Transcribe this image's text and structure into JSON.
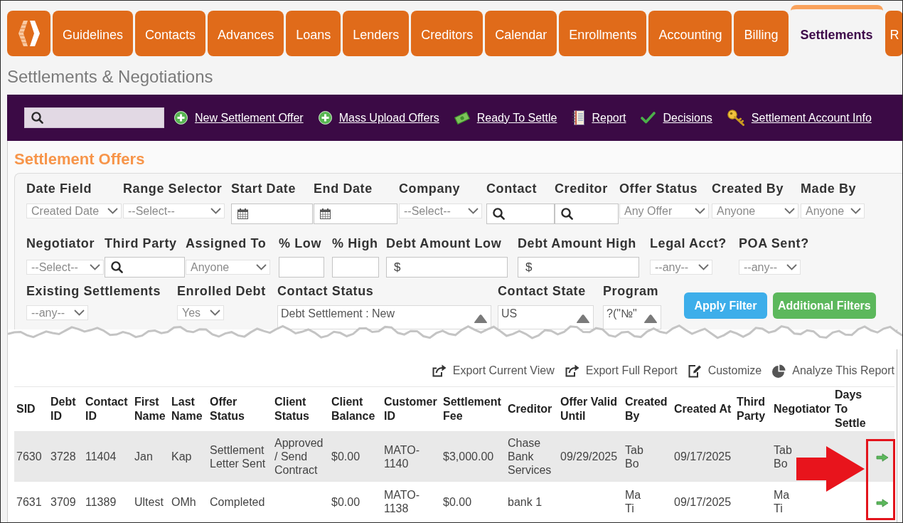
{
  "nav": {
    "tabs": [
      {
        "label": "Guidelines",
        "selected": false
      },
      {
        "label": "Contacts",
        "selected": false
      },
      {
        "label": "Advances",
        "selected": false
      },
      {
        "label": "Loans",
        "selected": false
      },
      {
        "label": "Lenders",
        "selected": false
      },
      {
        "label": "Creditors",
        "selected": false
      },
      {
        "label": "Calendar",
        "selected": false
      },
      {
        "label": "Enrollments",
        "selected": false
      },
      {
        "label": "Accounting",
        "selected": false
      },
      {
        "label": "Billing",
        "selected": false
      },
      {
        "label": "Settlements",
        "selected": true
      },
      {
        "label": "R",
        "selected": false
      }
    ]
  },
  "page_title": "Settlements & Negotiations",
  "toolbar": {
    "links": [
      {
        "label": "New Settlement Offer"
      },
      {
        "label": "Mass Upload Offers"
      },
      {
        "label": "Ready To Settle"
      },
      {
        "label": "Report"
      },
      {
        "label": "Decisions"
      },
      {
        "label": "Settlement Account Info"
      }
    ]
  },
  "settlement_offers": {
    "title": "Settlement Offers",
    "filter_rows": [
      {
        "fields": [
          {
            "label": "Date Field",
            "kind": "select",
            "value": "Created Date"
          },
          {
            "label": "Range Selector",
            "kind": "select",
            "value": "--Select--"
          },
          {
            "label": "Start Date",
            "kind": "date"
          },
          {
            "label": "End Date",
            "kind": "date"
          },
          {
            "label": "Company",
            "kind": "select",
            "value": "--Select--"
          },
          {
            "label": "Contact",
            "kind": "search"
          },
          {
            "label": "Creditor",
            "kind": "search"
          },
          {
            "label": "Offer Status",
            "kind": "select",
            "value": "Any Offer"
          },
          {
            "label": "Created By",
            "kind": "select",
            "value": "Anyone"
          },
          {
            "label": "Made By",
            "kind": "select",
            "value": "Anyone"
          }
        ]
      },
      {
        "fields": [
          {
            "label": "Negotiator",
            "kind": "select",
            "value": "--Select--"
          },
          {
            "label": "Third Party",
            "kind": "search"
          },
          {
            "label": "Assigned To",
            "kind": "select",
            "value": "Anyone"
          },
          {
            "label": "% Low",
            "kind": "text"
          },
          {
            "label": "% High",
            "kind": "text"
          },
          {
            "label": "Debt Amount Low",
            "kind": "money",
            "prefix": "$"
          },
          {
            "label": "Debt Amount High",
            "kind": "money",
            "prefix": "$"
          },
          {
            "label": "Legal Acct?",
            "kind": "select",
            "value": "--any--"
          },
          {
            "label": "POA Sent?",
            "kind": "select",
            "value": "--any--"
          }
        ]
      },
      {
        "fields": [
          {
            "label": "Existing Settlements",
            "kind": "select",
            "value": "--any--"
          },
          {
            "label": "Enrolled Debt",
            "kind": "select",
            "value": "Yes"
          },
          {
            "label": "Contact Status",
            "kind": "listbox",
            "options": [
              "Debt Settlement : New"
            ]
          },
          {
            "label": "Contact State",
            "kind": "listbox",
            "options": [
              "US"
            ]
          },
          {
            "label": "Program",
            "kind": "listbox",
            "options": [
              "?(\"№\""
            ]
          }
        ],
        "buttons": [
          {
            "label": "Apply Filter",
            "kind": "primary"
          },
          {
            "label": "Additional Filters",
            "kind": "success"
          }
        ]
      }
    ],
    "report_actions": [
      {
        "label": "Export Current View"
      },
      {
        "label": "Export Full Report"
      },
      {
        "label": "Customize"
      },
      {
        "label": "Analyze This Report"
      }
    ],
    "table": {
      "columns": [
        "SID",
        "Debt ID",
        "Contact ID",
        "First Name",
        "Last Name",
        "Offer Status",
        "Client Status",
        "Client Balance",
        "Customer ID",
        "Settlement Fee",
        "Creditor",
        "Offer Valid Until",
        "Created By",
        "Created At",
        "Third Party",
        "Negotiator",
        "Days To Settle"
      ],
      "rows": [
        {
          "sid": "7630",
          "debt_id": "3728",
          "contact_id": "11404",
          "first_name": "Jan",
          "last_name": "Kap",
          "offer_status": "Settlement Letter Sent",
          "client_status": "Approved / Send Contract",
          "client_balance": "$0.00",
          "customer_id": "MATO-1140",
          "settlement_fee": "$3,000.00",
          "creditor": "Chase Bank Services",
          "offer_valid_until": "09/29/2025",
          "created_by": "Tab Bo",
          "created_at": "09/17/2025",
          "negotiator": "Tab Bo"
        },
        {
          "sid": "7631",
          "debt_id": "3709",
          "contact_id": "11389",
          "first_name": "Ultest",
          "last_name": "OMh",
          "offer_status": "Completed",
          "client_balance": "$0.00",
          "customer_id": "MATO-1138",
          "settlement_fee": "$0.00",
          "creditor": "bank 1",
          "created_by": "Ma Ti",
          "created_at": "09/17/2025",
          "negotiator": "Ma Ti"
        }
      ]
    }
  }
}
